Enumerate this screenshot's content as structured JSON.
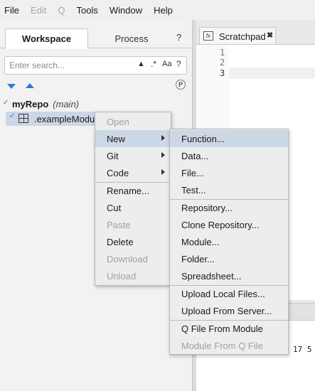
{
  "menubar": [
    {
      "label": "File",
      "enabled": true
    },
    {
      "label": "Edit",
      "enabled": false
    },
    {
      "label": "Q",
      "enabled": false
    },
    {
      "label": "Tools",
      "enabled": true
    },
    {
      "label": "Window",
      "enabled": true
    },
    {
      "label": "Help",
      "enabled": true
    }
  ],
  "left_panel": {
    "tabs": {
      "active": "Workspace",
      "inactive": "Process"
    },
    "help": "?",
    "search": {
      "placeholder": "Enter search...",
      "value": "",
      "regex": ".*",
      "case": "Aa",
      "help": "?"
    },
    "p_icon": "P",
    "tree": {
      "repo_name": "myRepo",
      "branch": "(main)",
      "module": ".exampleModule"
    }
  },
  "editor": {
    "tab_label": "Scratchpad",
    "tab_icon": "fx",
    "lines": [
      "1",
      "2",
      "3"
    ]
  },
  "console_output": "17 5",
  "context_menu": {
    "items": [
      "Open",
      "New",
      "Git",
      "Code",
      "Rename...",
      "Cut",
      "Paste",
      "Delete",
      "Download",
      "Unload"
    ],
    "disabled": [
      "Open",
      "Paste",
      "Download",
      "Unload"
    ],
    "with_submenu": [
      "New",
      "Git",
      "Code"
    ],
    "highlighted": "New"
  },
  "new_submenu": {
    "items": [
      "Function...",
      "Data...",
      "File...",
      "Test...",
      "Repository...",
      "Clone Repository...",
      "Module...",
      "Folder...",
      "Spreadsheet...",
      "Upload Local Files...",
      "Upload From Server...",
      "Q File From Module",
      "Module From Q File"
    ],
    "disabled": [
      "Module From Q File"
    ],
    "highlighted": "Function..."
  },
  "colors": {
    "accent": "#2d7bd1",
    "selection": "#cbd7e6",
    "menu_bg": "#ededed"
  }
}
